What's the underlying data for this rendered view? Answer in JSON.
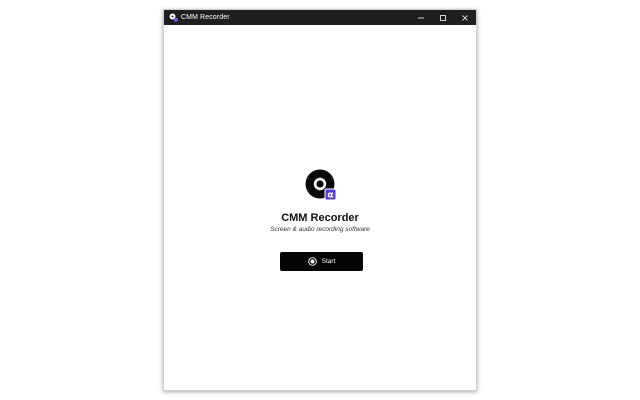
{
  "window": {
    "title": "CMM Recorder",
    "controls": {
      "minimize": "minimize-icon",
      "maximize": "maximize-icon",
      "close": "close-icon"
    }
  },
  "main": {
    "app_name": "CMM Recorder",
    "subtitle": "Screen & audio recording software",
    "logo_badge": "α",
    "start_button": {
      "label": "Start",
      "icon": "record-icon"
    }
  },
  "colors": {
    "titlebar": "#1f1f1f",
    "button": "#050505",
    "badge": "#5b3bd6",
    "background": "#ffffff"
  }
}
